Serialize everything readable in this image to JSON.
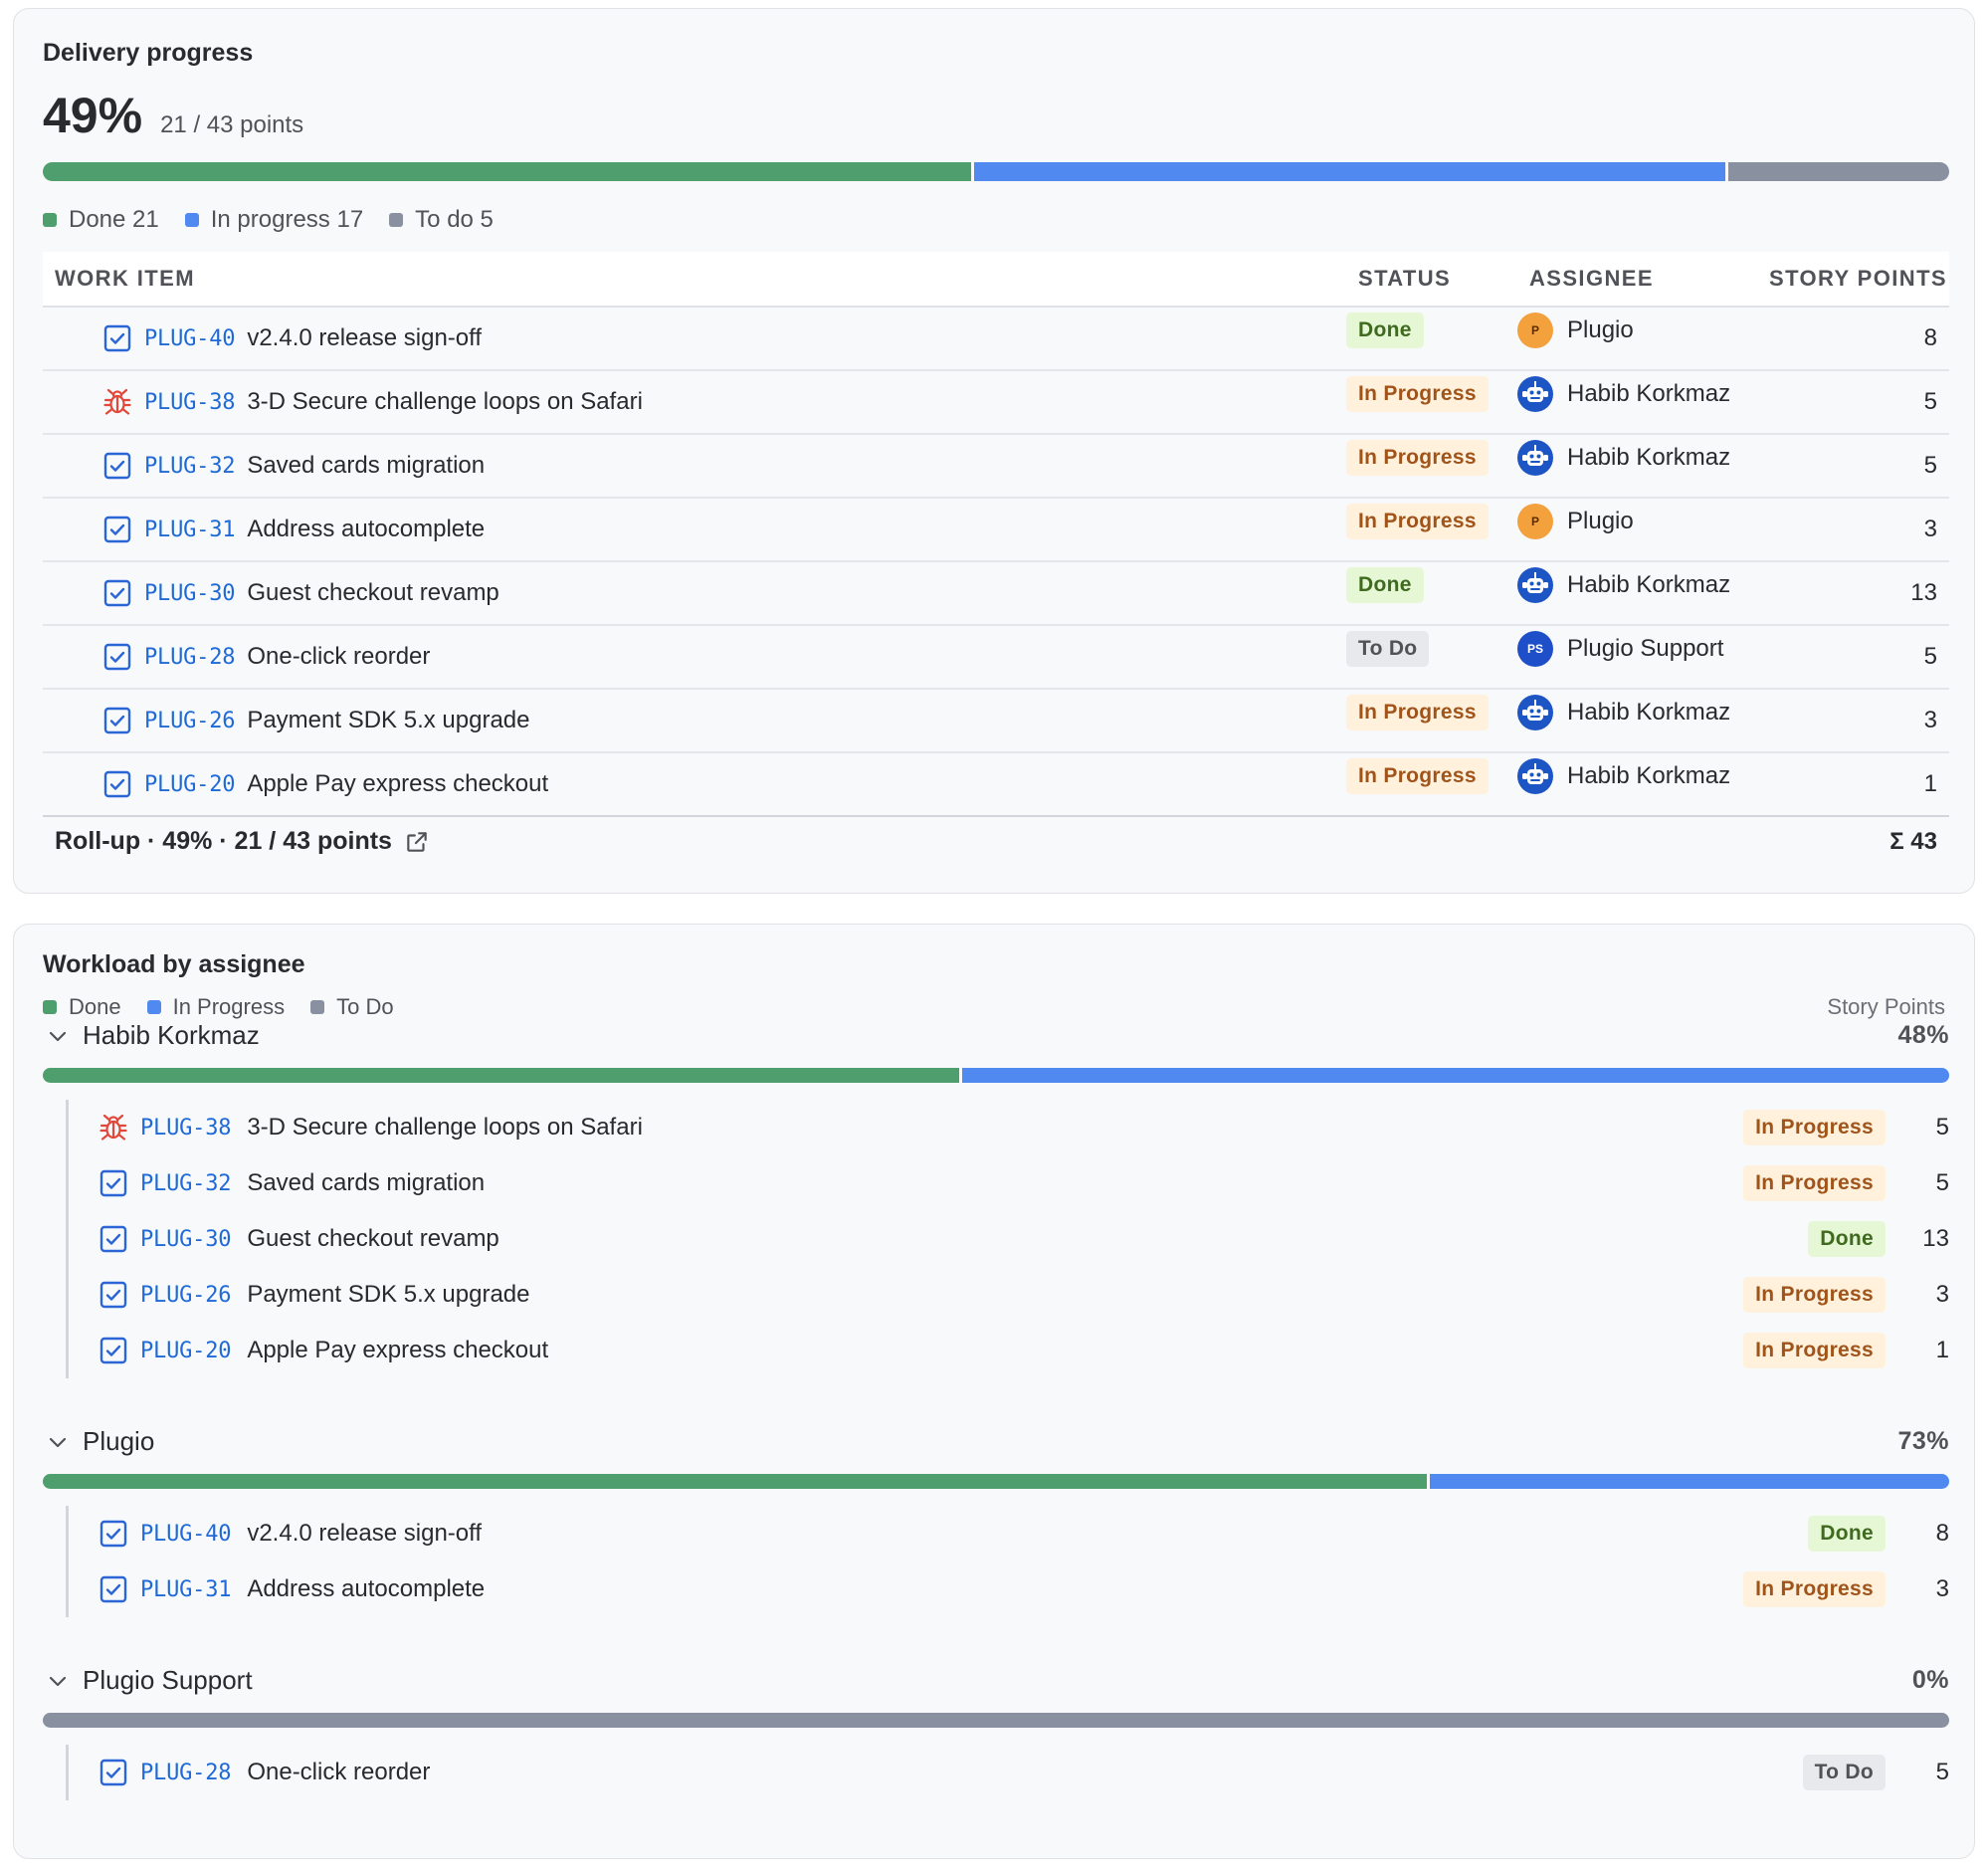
{
  "colors": {
    "done": "#4f9e6d",
    "in_progress": "#5089ef",
    "todo": "#8990a0"
  },
  "delivery": {
    "title": "Delivery progress",
    "percent": "49%",
    "points_text": "21 / 43 points",
    "segments": {
      "done": 21,
      "in_progress": 17,
      "todo": 5
    },
    "legend": {
      "done": "Done 21",
      "in_progress": "In progress 17",
      "todo": "To do 5"
    },
    "columns": {
      "item": "WORK ITEM",
      "status": "STATUS",
      "assignee": "ASSIGNEE",
      "points": "STORY POINTS"
    },
    "rows": [
      {
        "icon": "task-icon",
        "key": "PLUG-40",
        "summary": "v2.4.0 release sign-off",
        "status": "Done",
        "status_kind": "done",
        "assignee": "Plugio",
        "avatar": "P",
        "avatar_kind": "orange",
        "points": "8"
      },
      {
        "icon": "bug-icon",
        "key": "PLUG-38",
        "summary": "3-D Secure challenge loops on Safari",
        "status": "In Progress",
        "status_kind": "prog",
        "assignee": "Habib Korkmaz",
        "avatar": "",
        "avatar_kind": "blue",
        "points": "5"
      },
      {
        "icon": "task-icon",
        "key": "PLUG-32",
        "summary": "Saved cards migration",
        "status": "In Progress",
        "status_kind": "prog",
        "assignee": "Habib Korkmaz",
        "avatar": "",
        "avatar_kind": "blue",
        "points": "5"
      },
      {
        "icon": "task-icon",
        "key": "PLUG-31",
        "summary": "Address autocomplete",
        "status": "In Progress",
        "status_kind": "prog",
        "assignee": "Plugio",
        "avatar": "P",
        "avatar_kind": "orange",
        "points": "3"
      },
      {
        "icon": "task-icon",
        "key": "PLUG-30",
        "summary": "Guest checkout revamp",
        "status": "Done",
        "status_kind": "done",
        "assignee": "Habib Korkmaz",
        "avatar": "",
        "avatar_kind": "blue",
        "points": "13"
      },
      {
        "icon": "task-icon",
        "key": "PLUG-28",
        "summary": "One-click reorder",
        "status": "To Do",
        "status_kind": "todo",
        "assignee": "Plugio Support",
        "avatar": "PS",
        "avatar_kind": "ps",
        "points": "5"
      },
      {
        "icon": "task-icon",
        "key": "PLUG-26",
        "summary": "Payment SDK 5.x upgrade",
        "status": "In Progress",
        "status_kind": "prog",
        "assignee": "Habib Korkmaz",
        "avatar": "",
        "avatar_kind": "blue",
        "points": "3"
      },
      {
        "icon": "task-icon",
        "key": "PLUG-20",
        "summary": "Apple Pay express checkout",
        "status": "In Progress",
        "status_kind": "prog",
        "assignee": "Habib Korkmaz",
        "avatar": "",
        "avatar_kind": "blue",
        "points": "1"
      }
    ],
    "rollup_text": "Roll-up · 49% · 21 / 43 points",
    "rollup_total": "Σ 43"
  },
  "workload": {
    "title": "Workload by assignee",
    "legend": {
      "done": "Done",
      "in_progress": "In Progress",
      "todo": "To Do"
    },
    "axis_label": "Story Points",
    "groups": [
      {
        "name": "Habib Korkmaz",
        "percent": "48%",
        "segments": {
          "done": 13,
          "in_progress": 14,
          "todo": 0
        },
        "items": [
          {
            "icon": "bug-icon",
            "key": "PLUG-38",
            "summary": "3-D Secure challenge loops on Safari",
            "status": "In Progress",
            "status_kind": "prog",
            "points": "5"
          },
          {
            "icon": "task-icon",
            "key": "PLUG-32",
            "summary": "Saved cards migration",
            "status": "In Progress",
            "status_kind": "prog",
            "points": "5"
          },
          {
            "icon": "task-icon",
            "key": "PLUG-30",
            "summary": "Guest checkout revamp",
            "status": "Done",
            "status_kind": "done",
            "points": "13"
          },
          {
            "icon": "task-icon",
            "key": "PLUG-26",
            "summary": "Payment SDK 5.x upgrade",
            "status": "In Progress",
            "status_kind": "prog",
            "points": "3"
          },
          {
            "icon": "task-icon",
            "key": "PLUG-20",
            "summary": "Apple Pay express checkout",
            "status": "In Progress",
            "status_kind": "prog",
            "points": "1"
          }
        ]
      },
      {
        "name": "Plugio",
        "percent": "73%",
        "segments": {
          "done": 8,
          "in_progress": 3,
          "todo": 0
        },
        "items": [
          {
            "icon": "task-icon",
            "key": "PLUG-40",
            "summary": "v2.4.0 release sign-off",
            "status": "Done",
            "status_kind": "done",
            "points": "8"
          },
          {
            "icon": "task-icon",
            "key": "PLUG-31",
            "summary": "Address autocomplete",
            "status": "In Progress",
            "status_kind": "prog",
            "points": "3"
          }
        ]
      },
      {
        "name": "Plugio Support",
        "percent": "0%",
        "segments": {
          "done": 0,
          "in_progress": 0,
          "todo": 5
        },
        "items": [
          {
            "icon": "task-icon",
            "key": "PLUG-28",
            "summary": "One-click reorder",
            "status": "To Do",
            "status_kind": "todo",
            "points": "5"
          }
        ]
      }
    ]
  }
}
